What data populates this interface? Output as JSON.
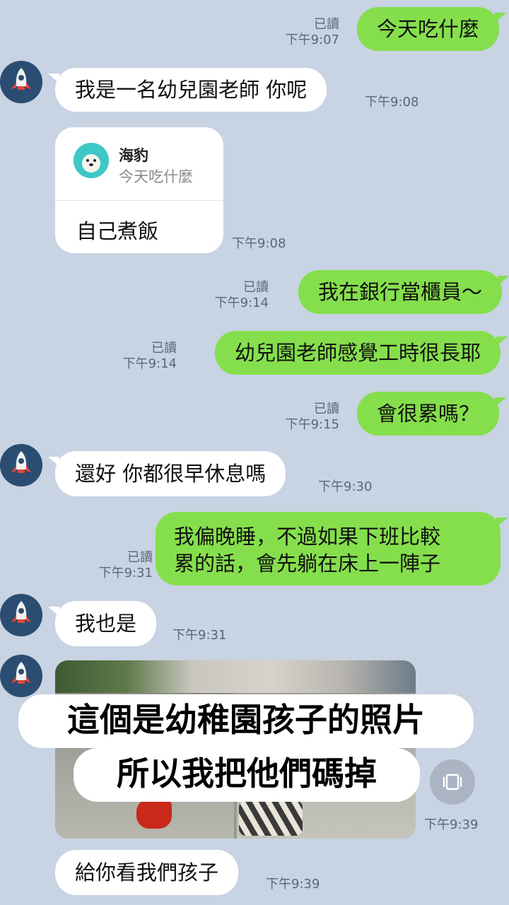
{
  "contact": {
    "name": "海豹"
  },
  "read_label": "已讀",
  "messages": [
    {
      "id": "m1",
      "dir": "out",
      "text": "今天吃什麼",
      "time": "下午9:07",
      "read": "已讀"
    },
    {
      "id": "m2",
      "dir": "in",
      "text": "我是一名幼兒園老師 你呢",
      "time": "下午9:08"
    },
    {
      "id": "m3",
      "dir": "in",
      "type": "reply",
      "quote_name": "海豹",
      "quote_text": "今天吃什麼",
      "text": "自己煮飯",
      "time": "下午9:08"
    },
    {
      "id": "m4",
      "dir": "out",
      "text": "我在銀行當櫃員～",
      "time": "下午9:14",
      "read": "已讀"
    },
    {
      "id": "m5",
      "dir": "out",
      "text": "幼兒園老師感覺工時很長耶",
      "time": "下午9:14",
      "read": "已讀"
    },
    {
      "id": "m6",
      "dir": "out",
      "text": "會很累嗎？",
      "time": "下午9:15",
      "read": "已讀"
    },
    {
      "id": "m7",
      "dir": "in",
      "text": "還好 你都很早休息嗎",
      "time": "下午9:30"
    },
    {
      "id": "m8",
      "dir": "out",
      "line1": "我偏晚睡，不過如果下班比較",
      "line2": "累的話，會先躺在床上一陣子",
      "time": "下午9:31",
      "read": "已讀"
    },
    {
      "id": "m9",
      "dir": "in",
      "text": "我也是",
      "time": "下午9:31"
    },
    {
      "id": "m10",
      "dir": "in",
      "type": "photo",
      "time": "下午9:39",
      "caption_line1": "這個是幼稚園孩子的照片",
      "caption_line2": "所以我把他們碼掉"
    },
    {
      "id": "m11",
      "dir": "in",
      "text": "給你看我們孩子",
      "time": "下午9:39"
    }
  ],
  "icons": {
    "avatar": "rocket-icon",
    "quote_avatar": "seal-icon",
    "save": "save-image-icon"
  },
  "colors": {
    "background": "#c8d3e3",
    "outgoing": "#85df4c",
    "incoming": "#ffffff",
    "meta": "#5d6774"
  }
}
